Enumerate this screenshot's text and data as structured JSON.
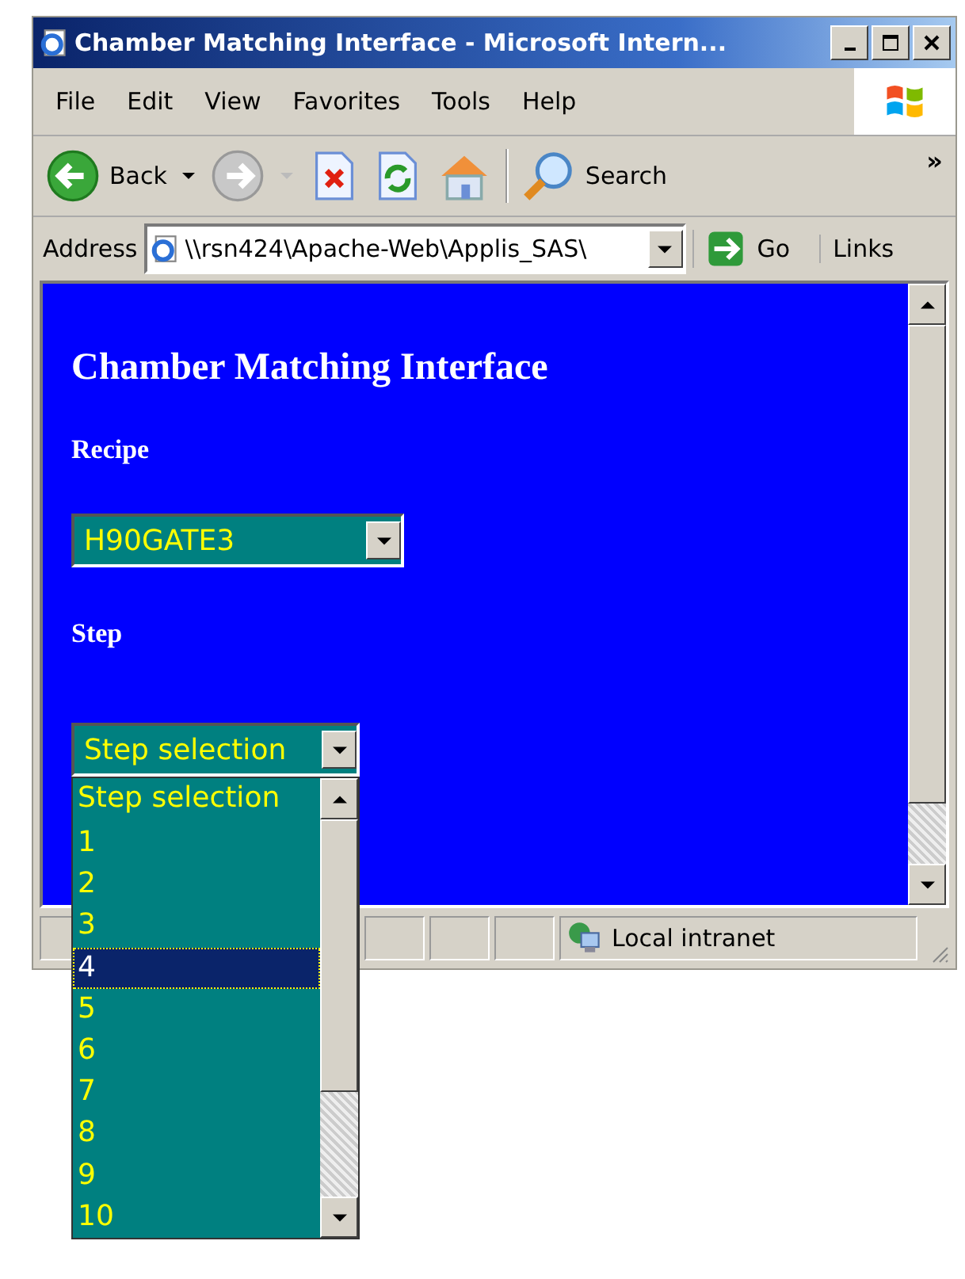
{
  "window": {
    "title": "Chamber Matching Interface - Microsoft Intern..."
  },
  "menu": [
    "File",
    "Edit",
    "View",
    "Favorites",
    "Tools",
    "Help"
  ],
  "toolbar": {
    "back": "Back",
    "search": "Search",
    "more": "»"
  },
  "address": {
    "label": "Address",
    "value": "\\\\rsn424\\Apache-Web\\Applis_SAS\\",
    "go": "Go",
    "links": "Links"
  },
  "page": {
    "heading": "Chamber Matching Interface",
    "recipe_label": "Recipe",
    "recipe_value": "H90GATE3",
    "step_label": "Step",
    "step_value": "Step selection",
    "step_options": [
      {
        "label": "Step selection",
        "selected": false
      },
      {
        "label": "1",
        "selected": false
      },
      {
        "label": "2",
        "selected": false
      },
      {
        "label": "3",
        "selected": false
      },
      {
        "label": "4",
        "selected": true
      },
      {
        "label": "5",
        "selected": false
      },
      {
        "label": "6",
        "selected": false
      },
      {
        "label": "7",
        "selected": false
      },
      {
        "label": "8",
        "selected": false
      },
      {
        "label": "9",
        "selected": false
      },
      {
        "label": "10",
        "selected": false
      }
    ]
  },
  "status_bar": {
    "zone": "Local intranet"
  }
}
